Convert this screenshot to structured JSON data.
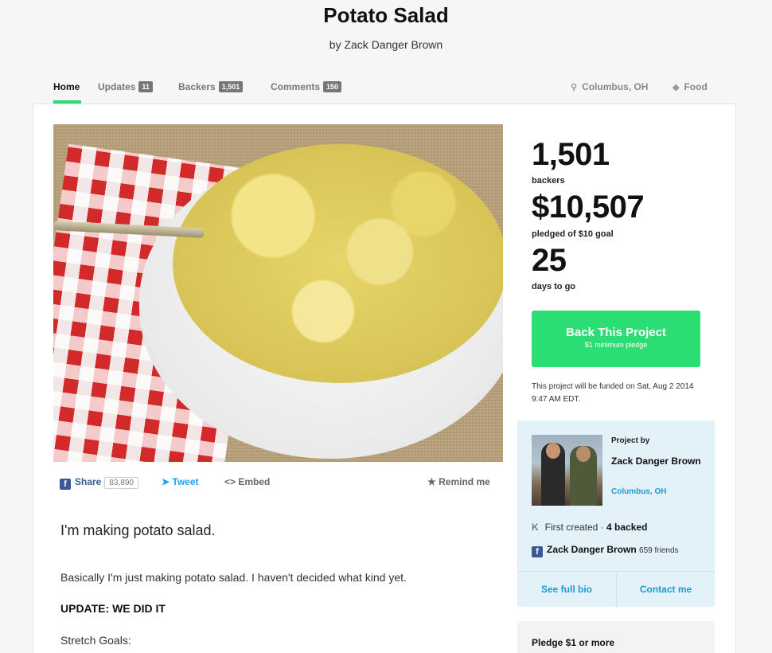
{
  "project": {
    "title": "Potato Salad",
    "byline": "by Zack Danger Brown"
  },
  "nav": {
    "home": "Home",
    "updates": {
      "label": "Updates",
      "count": "11"
    },
    "backers": {
      "label": "Backers",
      "count": "1,501"
    },
    "comments": {
      "label": "Comments",
      "count": "150"
    },
    "location": "Columbus, OH",
    "category": "Food"
  },
  "share": {
    "share_label": "Share",
    "share_count": "83,890",
    "tweet_label": "Tweet",
    "embed_label": "Embed",
    "remind_label": "Remind me"
  },
  "description": {
    "lead": "I'm making potato salad.",
    "para1": "Basically I'm just making potato salad. I haven't decided what kind yet.",
    "para2": "UPDATE: WE DID IT",
    "para3": "Stretch Goals:"
  },
  "stats": {
    "backers_count": "1,501",
    "backers_label": "backers",
    "pledged_amount": "$10,507",
    "pledged_label": "pledged of $10 goal",
    "days_count": "25",
    "days_label": "days to go"
  },
  "cta": {
    "label": "Back This Project",
    "sublabel": "$1 minimum pledge"
  },
  "funding_note": "This project will be funded on Sat, Aug 2 2014 9:47 AM EDT.",
  "creator": {
    "project_by": "Project by",
    "name": "Zack Danger Brown",
    "location": "Columbus, OH",
    "first_created": "First created",
    "backed": "4 backed",
    "fb_name": "Zack Danger Brown",
    "fb_friends": "659 friends",
    "see_bio": "See full bio",
    "contact": "Contact me"
  },
  "reward": {
    "title": "Pledge $1 or more"
  },
  "colors": {
    "accent_green": "#2bde73",
    "link_blue": "#1d9bd6",
    "facebook_blue": "#3b5998",
    "twitter_blue": "#1da1f2",
    "creator_bg": "#e3f1f9"
  }
}
